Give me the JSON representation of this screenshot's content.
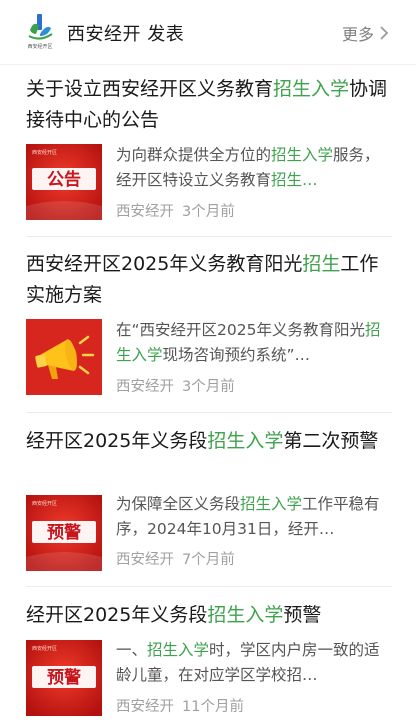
{
  "header": {
    "account_name": "西安经开 发表",
    "more_label": "更多",
    "logo_caption": "西安经开区"
  },
  "articles": [
    {
      "title_parts": [
        "关于设立西安经开区义务教育",
        "招生入学",
        "协调接待中心的公告"
      ],
      "summary_parts": [
        "为向群众提供全方位的",
        "招生入学",
        "服务，经开区特设立义务教育",
        "招生…"
      ],
      "source": "西安经开",
      "time": "3个月前",
      "thumb_text": "公告",
      "thumb_type": "announcement"
    },
    {
      "title_parts": [
        "西安经开区2025年义务教育阳光",
        "招生",
        "工作实施方案"
      ],
      "summary_parts": [
        "在“西安经开区2025年义务教育阳光",
        "招生入学",
        "现场咨询预约系统”…"
      ],
      "source": "西安经开",
      "time": "3个月前",
      "thumb_text": "",
      "thumb_type": "megaphone"
    },
    {
      "title_parts": [
        "经开区2025年义务段",
        "招生入学",
        "第二次预警"
      ],
      "summary_parts": [
        "为保障全区义务段",
        "招生入学",
        "工作平稳有序，2024年10月31日，经开…"
      ],
      "source": "西安经开",
      "time": "7个月前",
      "thumb_text": "预警",
      "thumb_type": "warning"
    },
    {
      "title_parts": [
        "经开区2025年义务段",
        "招生入学",
        "预警"
      ],
      "summary_parts": [
        "一、",
        "招生入学",
        "时，学区内户房一致的适龄儿童，在对应学区学校招…"
      ],
      "source": "西安经开",
      "time": "11个月前",
      "thumb_text": "预警",
      "thumb_type": "warning"
    }
  ],
  "colors": {
    "highlight": "#3fa34d",
    "thumb_red": "#d71f1f"
  }
}
